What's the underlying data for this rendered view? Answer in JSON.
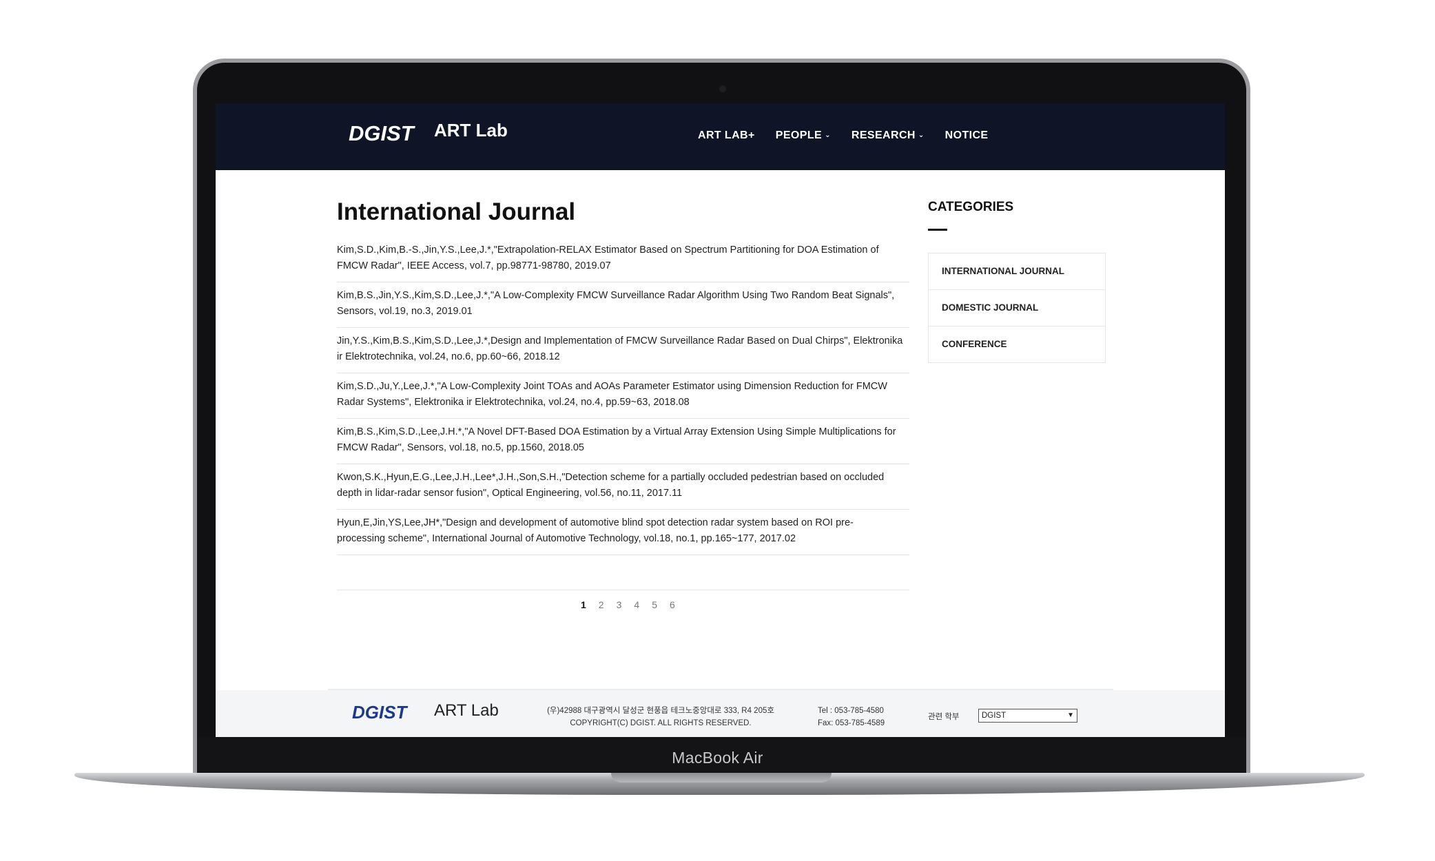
{
  "device": {
    "label": "MacBook Air"
  },
  "header": {
    "logo_text": "ART Lab",
    "nav": [
      {
        "label": "ART LAB+",
        "dropdown": false
      },
      {
        "label": "PEOPLE",
        "dropdown": true
      },
      {
        "label": "RESEARCH",
        "dropdown": true
      },
      {
        "label": "NOTICE",
        "dropdown": false
      }
    ]
  },
  "main": {
    "title": "International Journal",
    "publications": [
      {
        "line1": "Kim,S.D.,Kim,B.-S.,Jin,Y.S.,Lee,J.*,\"Extrapolation-RELAX Estimator Based on Spectrum Partitioning for DOA Estimation of",
        "line2": "FMCW Radar\", IEEE Access, vol.7, pp.98771-98780, 2019.07"
      },
      {
        "line1": "Kim,B.S.,Jin,Y.S.,Kim,S.D.,Lee,J.*,\"A Low-Complexity FMCW Surveillance Radar Algorithm Using Two Random Beat Signals\",",
        "line2": "Sensors, vol.19, no.3, 2019.01"
      },
      {
        "line1": "Jin,Y.S.,Kim,B.S.,Kim,S.D.,Lee,J.*,Design and Implementation of FMCW Surveillance Radar Based on Dual Chirps\", Elektronika",
        "line2": "ir Elektrotechnika, vol.24, no.6, pp.60~66, 2018.12"
      },
      {
        "line1": "Kim,S.D.,Ju,Y.,Lee,J.*,\"A Low-Complexity Joint TOAs and AOAs Parameter Estimator using Dimension Reduction for FMCW",
        "line2": "Radar Systems\", Elektronika ir Elektrotechnika, vol.24, no.4, pp.59~63, 2018.08"
      },
      {
        "line1": "Kim,B.S.,Kim,S.D.,Lee,J.H.*,\"A Novel DFT-Based DOA Estimation by a Virtual Array Extension Using Simple Multiplications for",
        "line2": "FMCW Radar\", Sensors, vol.18, no.5, pp.1560, 2018.05"
      },
      {
        "line1": "Kwon,S.K.,Hyun,E.G.,Lee,J.H.,Lee*,J.H.,Son,S.H.,\"Detection scheme for a partially occluded pedestrian based on occluded",
        "line2": "depth in lidar-radar sensor fusion\", Optical Engineering, vol.56, no.11, 2017.11"
      },
      {
        "line1": "Hyun,E,Jin,YS,Lee,JH*,\"Design and development of automotive blind spot detection radar system based on ROI pre-",
        "line2": "processing scheme\", International Journal of Automotive Technology, vol.18, no.1, pp.165~177, 2017.02"
      }
    ],
    "pagination": {
      "pages": [
        "1",
        "2",
        "3",
        "4",
        "5",
        "6"
      ],
      "current": "1"
    }
  },
  "sidebar": {
    "title": "CATEGORIES",
    "categories": [
      "INTERNATIONAL JOURNAL",
      "DOMESTIC JOURNAL",
      "CONFERENCE"
    ]
  },
  "footer": {
    "logo_text": "ART Lab",
    "address": "(우)42988 대구광역시 달성군 현풍읍 테크노중앙대로 333, R4 205호",
    "copyright": "COPYRIGHT(C) DGIST. ALL RIGHTS RESERVED.",
    "tel": "Tel : 053-785-4580",
    "fax": "Fax: 053-785-4589",
    "related_label": "관련 학부",
    "select_value": "DGIST"
  },
  "colors": {
    "header_bg": "#0f1426",
    "footer_bg": "#f4f5f7",
    "text": "#222222"
  },
  "icons": [
    "dgist-logo-icon",
    "chevron-down-icon"
  ]
}
